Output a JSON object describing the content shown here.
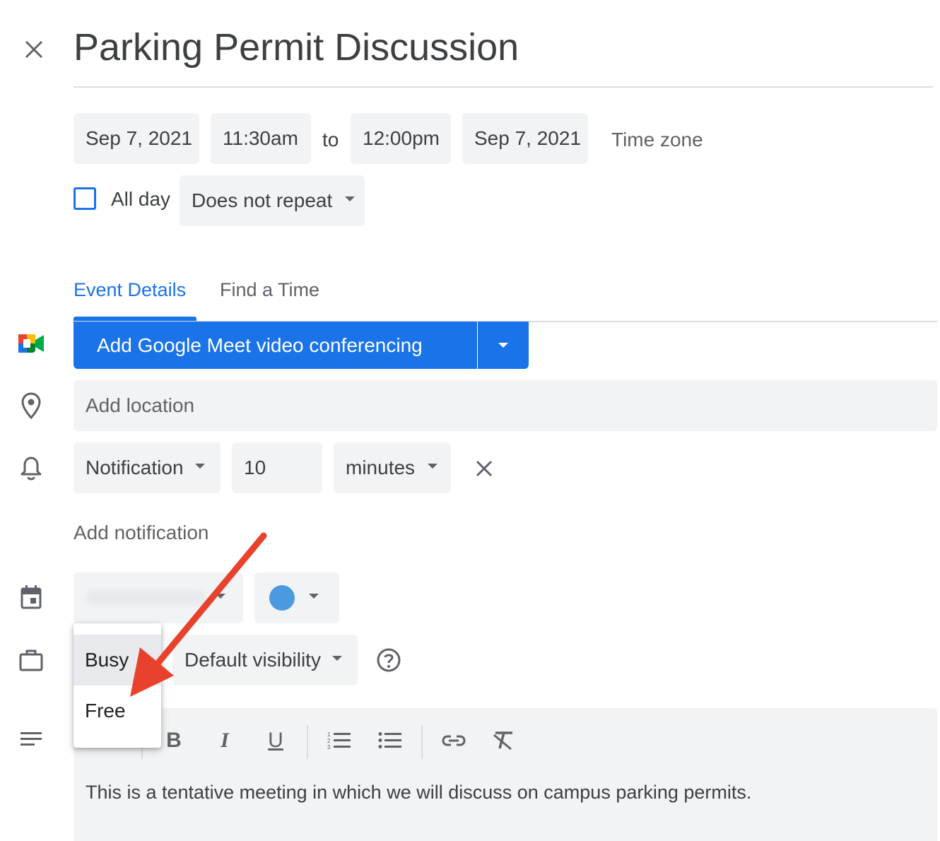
{
  "header": {
    "title": "Parking Permit Discussion",
    "close_icon": "close-icon"
  },
  "datetime": {
    "start_date": "Sep 7, 2021",
    "start_time": "11:30am",
    "to_label": "to",
    "end_time": "12:00pm",
    "end_date": "Sep 7, 2021",
    "time_zone_label": "Time zone"
  },
  "all_day": {
    "label": "All day",
    "checked": false
  },
  "repeat": {
    "value": "Does not repeat"
  },
  "tabs": [
    {
      "label": "Event Details",
      "active": true
    },
    {
      "label": "Find a Time",
      "active": false
    }
  ],
  "meet": {
    "button_label": "Add Google Meet video conferencing"
  },
  "location": {
    "placeholder": "Add location"
  },
  "notification": {
    "type": "Notification",
    "amount": "10",
    "unit": "minutes",
    "add_label": "Add notification"
  },
  "calendar": {
    "color": "#4a9ae0"
  },
  "availability": {
    "options": [
      "Busy",
      "Free"
    ],
    "selected": "Busy",
    "visibility": "Default visibility"
  },
  "description": {
    "text": "This is a tentative meeting in which we will discuss on campus parking permits."
  },
  "colors": {
    "accent": "#1a73e8",
    "annotation_arrow": "#e8412c"
  }
}
